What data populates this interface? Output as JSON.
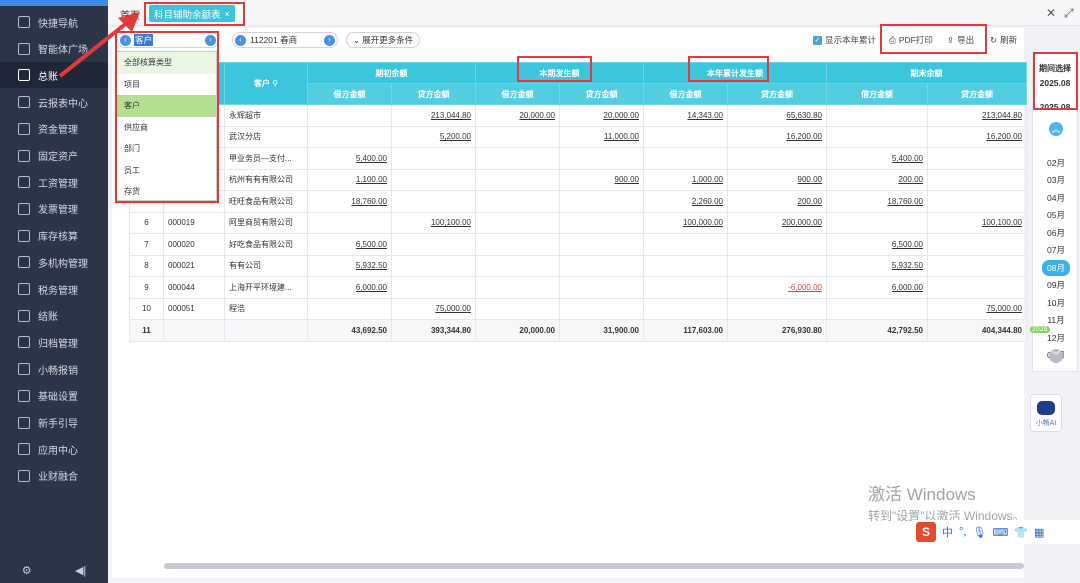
{
  "sidebar": {
    "items": [
      {
        "label": "快捷导航",
        "icon": "home-icon"
      },
      {
        "label": "智能体广场",
        "icon": "agent-icon"
      },
      {
        "label": "总账",
        "icon": "ledger-icon"
      },
      {
        "label": "云报表中心",
        "icon": "chart-icon"
      },
      {
        "label": "资金管理",
        "icon": "money-icon"
      },
      {
        "label": "固定资产",
        "icon": "asset-icon"
      },
      {
        "label": "工资管理",
        "icon": "salary-icon"
      },
      {
        "label": "发票管理",
        "icon": "invoice-icon"
      },
      {
        "label": "库存核算",
        "icon": "inventory-icon"
      },
      {
        "label": "多机构管理",
        "icon": "org-icon"
      },
      {
        "label": "税务管理",
        "icon": "tax-icon"
      },
      {
        "label": "结账",
        "icon": "close-book-icon"
      },
      {
        "label": "归档管理",
        "icon": "archive-icon"
      },
      {
        "label": "小畅报销",
        "icon": "reimburse-icon"
      },
      {
        "label": "基础设置",
        "icon": "settings-icon"
      },
      {
        "label": "新手引导",
        "icon": "guide-icon"
      },
      {
        "label": "应用中心",
        "icon": "apps-icon"
      },
      {
        "label": "业财融合",
        "icon": "fusion-icon"
      }
    ],
    "footer": {
      "settings": "⚙",
      "collapse": "◀|"
    }
  },
  "tabs": {
    "home": "首页",
    "active": "科目辅助余额表",
    "close": "×"
  },
  "window": {
    "restore": "⤢",
    "close": "✕"
  },
  "toolbar": {
    "aux_type": "客户",
    "account": "112201 春商",
    "expand": "展开更多条件",
    "show_year": "显示本年累计",
    "pdf": "PDF打印",
    "export": "导出",
    "refresh": "刷新"
  },
  "dropdown": [
    "全部核算类型",
    "项目",
    "客户",
    "供应商",
    "部门",
    "员工",
    "存货"
  ],
  "table": {
    "groups": [
      "期初余额",
      "本期发生额",
      "本年累计发生额",
      "期末余额"
    ],
    "customer_header": "客户",
    "subheaders": [
      "借方金额",
      "贷方金额",
      "借方金额",
      "贷方金额",
      "借方金额",
      "贷方金额",
      "借方金额",
      "贷方金额"
    ],
    "rows": [
      {
        "no": "",
        "code": "",
        "name": "永辉超市",
        "v": [
          "",
          "213,044.80",
          "20,000.00",
          "20,000.00",
          "14,343.00",
          "65,630.80",
          "",
          "213,044.80"
        ]
      },
      {
        "no": "",
        "code": "",
        "name": "武汉分店",
        "v": [
          "",
          "5,200.00",
          "",
          "11,000.00",
          "",
          "16,200.00",
          "",
          "16,200.00"
        ]
      },
      {
        "no": "",
        "code": "",
        "name": "甲业务员—支付...",
        "v": [
          "5,400.00",
          "",
          "",
          "",
          "",
          "",
          "5,400.00",
          ""
        ]
      },
      {
        "no": "",
        "code": "",
        "name": "杭州有有有限公司",
        "v": [
          "1,100.00",
          "",
          "",
          "900.00",
          "1,000.00",
          "900.00",
          "200.00",
          ""
        ]
      },
      {
        "no": "",
        "code": "",
        "name": "旺旺食品有限公司",
        "v": [
          "18,760.00",
          "",
          "",
          "",
          "2,260.00",
          "200.00",
          "18,760.00",
          ""
        ]
      },
      {
        "no": "6",
        "code": "000019",
        "name": "阿里商贸有限公司",
        "v": [
          "",
          "100,100.00",
          "",
          "",
          "100,000.00",
          "200,000.00",
          "",
          "100,100.00"
        ]
      },
      {
        "no": "7",
        "code": "000020",
        "name": "好吃食品有限公司",
        "v": [
          "6,500.00",
          "",
          "",
          "",
          "",
          "",
          "6,500.00",
          ""
        ]
      },
      {
        "no": "8",
        "code": "000021",
        "name": "有有公司",
        "v": [
          "5,932.50",
          "",
          "",
          "",
          "",
          "",
          "5,932.50",
          ""
        ]
      },
      {
        "no": "9",
        "code": "000044",
        "name": "上海开平环境建...",
        "v": [
          "6,000.00",
          "",
          "",
          "",
          "",
          "-6,000.00",
          "6,000.00",
          ""
        ]
      },
      {
        "no": "10",
        "code": "000051",
        "name": "程浩",
        "v": [
          "",
          "75,000.00",
          "",
          "",
          "",
          "",
          "",
          "75,000.00"
        ]
      }
    ],
    "total": {
      "no": "11",
      "v": [
        "43,692.50",
        "393,344.80",
        "20,000.00",
        "31,900.00",
        "117,603.00",
        "276,930.80",
        "42,792.50",
        "404,344.80"
      ]
    }
  },
  "period": {
    "title": "期间选择",
    "from": "2025.08",
    "to": "2025.08",
    "months": [
      "02月",
      "03月",
      "04月",
      "05月",
      "06月",
      "07月",
      "08月",
      "09月",
      "10月",
      "11月",
      "12月",
      "01月"
    ],
    "year_badge": "2026"
  },
  "ai": {
    "label": "小畅AI"
  },
  "watermark": {
    "line1": "激活 Windows",
    "line2": "转到\"设置\"以激活 Windows。"
  },
  "ime": {
    "logo": "S",
    "lang": "中",
    "punct": "°,"
  }
}
